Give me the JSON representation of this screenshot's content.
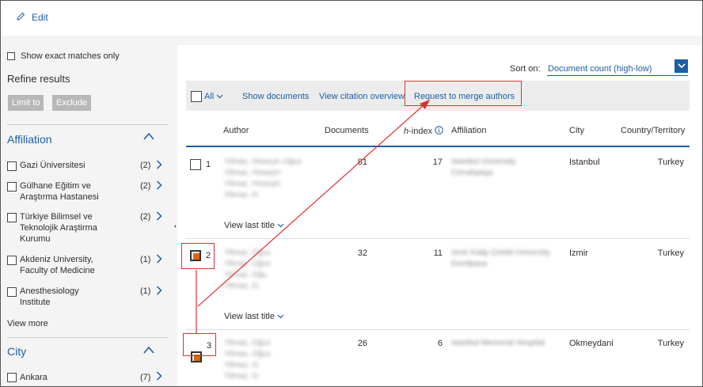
{
  "topbar": {
    "edit_label": "Edit"
  },
  "sidebar": {
    "exact_matches_label": "Show exact matches only",
    "refine_title": "Refine results",
    "limit_to": "Limit to",
    "exclude": "Exclude",
    "affiliation_title": "Affiliation",
    "affiliations": [
      {
        "l1": "Gazi Üniversitesi",
        "l2": "",
        "l3": "",
        "count": "(2)"
      },
      {
        "l1": "Gülhane Eğitim ve",
        "l2": "Araştırma Hastanesi",
        "l3": "",
        "count": "(2)"
      },
      {
        "l1": "Türkiye Bilimsel ve",
        "l2": "Teknolojik Araştirma",
        "l3": "Kurumu",
        "count": "(2)"
      },
      {
        "l1": "Akdeniz University,",
        "l2": "Faculty of Medicine",
        "l3": "",
        "count": "(1)"
      },
      {
        "l1": "Anesthesiology",
        "l2": "Institute",
        "l3": "",
        "count": "(1)"
      }
    ],
    "view_more": "View more",
    "city_title": "City",
    "cities": [
      {
        "name": "Ankara",
        "count": "(7)"
      }
    ]
  },
  "toolbar": {
    "sort_label": "Sort on:",
    "sort_value": "Document count (high-low)",
    "all_label": "All",
    "show_documents": "Show documents",
    "view_citation": "View citation overview",
    "merge_authors": "Request to merge authors"
  },
  "table": {
    "headers": {
      "author": "Author",
      "documents": "Documents",
      "hindex_h": "h",
      "hindex_rest": "-index",
      "affiliation": "Affiliation",
      "city": "City",
      "country": "Country/Territory"
    },
    "view_last_title": "View last title",
    "rows": [
      {
        "num": "1",
        "documents": "81",
        "hindex": "17",
        "city": "Istanbul",
        "country": "Turkey",
        "name_lines": [
          "Yilmaz, Hüseyin Oğuz",
          "Yilmaz, Hüseyin",
          "Yilmaz, Hüseyin",
          "Yilmaz, H."
        ],
        "aff_lines": [
          "Istanbul University",
          "Cerrahpaşa"
        ]
      },
      {
        "num": "2",
        "documents": "32",
        "hindex": "11",
        "city": "Izmir",
        "country": "Turkey",
        "name_lines": [
          "Yilmaz, Oğuz",
          "Yilmaz, Oğuz",
          "Yilmaz, Oğu",
          "Yilmaz, O."
        ],
        "aff_lines": [
          "Izmir Katip Çelebi University",
          "Esrefpasa"
        ]
      },
      {
        "num": "3",
        "documents": "26",
        "hindex": "6",
        "city": "Okmeydani",
        "country": "Turkey",
        "name_lines": [
          "Yilmaz, Oğuz",
          "Yilmaz, Oğuz",
          "Yilmaz, O.",
          "Yilmaz, O."
        ],
        "aff_lines": [
          "Istanbul Memorial Hospital"
        ]
      }
    ]
  },
  "colors": {
    "accent": "#1d5ea8",
    "annotation": "#e03030",
    "checked": "#e8620a"
  }
}
